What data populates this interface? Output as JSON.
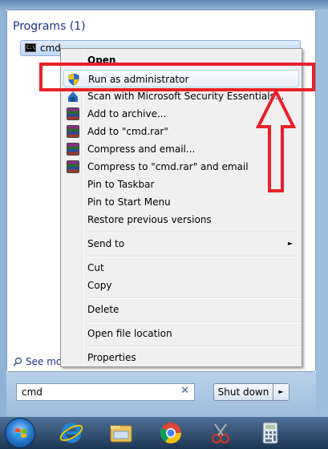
{
  "start_menu": {
    "programs_header": "Programs (1)",
    "program_item": {
      "label": "cmd",
      "icon": "cmd-icon"
    },
    "see_more": "See mo",
    "search": {
      "value": "cmd",
      "clear_glyph": "✕"
    },
    "shutdown": {
      "label": "Shut down",
      "arrow": "►"
    }
  },
  "context_menu": {
    "items": [
      {
        "label": "Open",
        "bold": true,
        "icon": ""
      },
      {
        "label": "Run as administrator",
        "icon": "uac-shield-icon",
        "highlighted": true
      },
      {
        "label": "Scan with Microsoft Security Essentials...",
        "icon": "security-essentials-icon"
      },
      {
        "label": "Add to archive...",
        "icon": "winrar-icon"
      },
      {
        "label": "Add to \"cmd.rar\"",
        "icon": "winrar-icon"
      },
      {
        "label": "Compress and email...",
        "icon": "winrar-icon"
      },
      {
        "label": "Compress to \"cmd.rar\" and email",
        "icon": "winrar-icon"
      },
      {
        "label": "Pin to Taskbar",
        "icon": ""
      },
      {
        "label": "Pin to Start Menu",
        "icon": ""
      },
      {
        "label": "Restore previous versions",
        "icon": ""
      },
      {
        "label": "Send to",
        "icon": "",
        "submenu": true,
        "submenu_glyph": "►"
      },
      {
        "label": "Cut",
        "icon": ""
      },
      {
        "label": "Copy",
        "icon": ""
      },
      {
        "label": "Delete",
        "icon": ""
      },
      {
        "label": "Open file location",
        "icon": ""
      },
      {
        "label": "Properties",
        "icon": ""
      }
    ]
  },
  "taskbar": {
    "icons": [
      "start-orb-icon",
      "internet-explorer-icon",
      "file-explorer-icon",
      "chrome-icon",
      "snipping-tool-icon",
      "calculator-icon"
    ]
  },
  "colors": {
    "highlight_red": "#e8202a",
    "header_blue": "#1e3287",
    "taskbar_top": "#4f7196",
    "taskbar_bottom": "#1c3554"
  }
}
